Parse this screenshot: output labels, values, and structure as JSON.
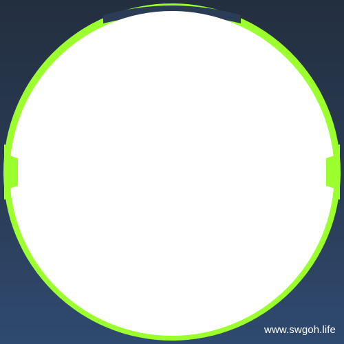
{
  "frame": {
    "ring_color": "#9cff2e",
    "inner_color": "#ffffff",
    "background_top": "#232f3f",
    "background_bottom": "#2f4a70",
    "top_gap_color": "#2a3c56"
  },
  "watermark": {
    "text": "www.swgoh.life"
  }
}
